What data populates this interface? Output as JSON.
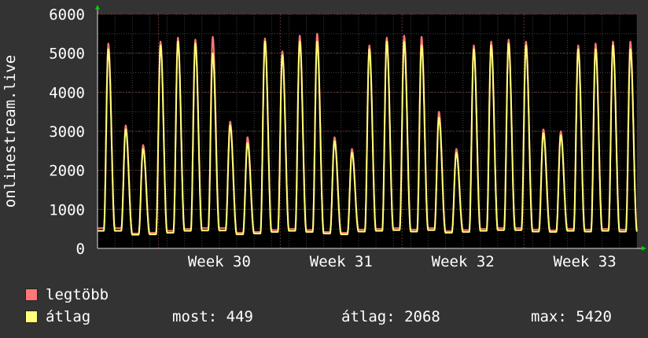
{
  "chart_data": {
    "type": "area",
    "ylabel": "onlinestream.live",
    "ylim": [
      0,
      6000
    ],
    "y_ticks": [
      0,
      1000,
      2000,
      3000,
      4000,
      5000,
      6000
    ],
    "x_ticks": [
      "Week 30",
      "Week 31",
      "Week 32",
      "Week 33"
    ],
    "grid": true,
    "days": 31,
    "series": [
      {
        "name": "legtöbb",
        "color": "#ff7777",
        "daily_peaks": [
          5250,
          3150,
          2650,
          5300,
          5400,
          5350,
          5420,
          3250,
          2850,
          5380,
          5050,
          5450,
          5500,
          2850,
          2550,
          5200,
          5400,
          5450,
          5420,
          3500,
          2550,
          5200,
          5300,
          5350,
          5300,
          3050,
          3000,
          5200,
          5250,
          5300,
          5300
        ],
        "daily_troughs": [
          520,
          520,
          380,
          400,
          450,
          500,
          520,
          520,
          400,
          420,
          470,
          500,
          470,
          420,
          400,
          480,
          500,
          520,
          480,
          520,
          440,
          470,
          500,
          520,
          520,
          480,
          460,
          500,
          480,
          500,
          480
        ]
      },
      {
        "name": "átlag",
        "color": "#ffff77",
        "daily_peaks": [
          5100,
          3050,
          2550,
          5200,
          5300,
          5250,
          5000,
          3150,
          2700,
          5300,
          4950,
          5300,
          5300,
          2750,
          2450,
          5100,
          5300,
          5300,
          5200,
          3350,
          2450,
          5100,
          5200,
          5250,
          5200,
          2950,
          2900,
          5100,
          5100,
          5200,
          5100
        ],
        "daily_troughs": [
          450,
          450,
          350,
          360,
          400,
          450,
          460,
          460,
          360,
          380,
          420,
          450,
          420,
          380,
          360,
          430,
          450,
          470,
          430,
          470,
          400,
          420,
          450,
          470,
          470,
          430,
          420,
          450,
          430,
          450,
          430
        ]
      }
    ]
  },
  "legend": {
    "items": [
      {
        "label": "legtöbb",
        "color": "#ff7777"
      },
      {
        "label": "átlag",
        "color": "#ffff77"
      }
    ]
  },
  "stats": {
    "most": "most: 449",
    "atlag": "átlag: 2068",
    "max": "max: 5420"
  },
  "colors": {
    "background": "#333333",
    "plot_background": "#000000",
    "grid": "#444444",
    "week_grid": "#663333",
    "arrow": "#00cc00"
  }
}
